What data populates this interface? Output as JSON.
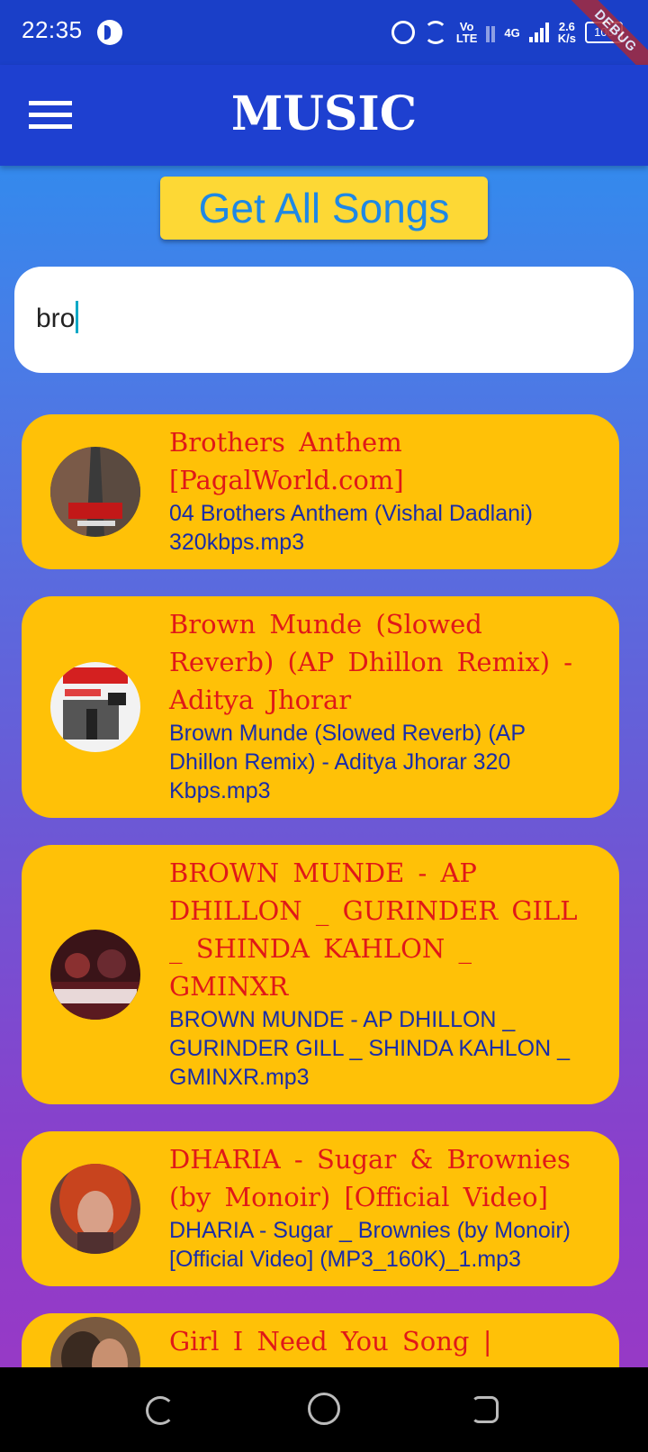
{
  "status_bar": {
    "time": "22:35",
    "volte_top": "Vo",
    "volte_bottom": "LTE",
    "network": "4G",
    "speed_value": "2.6",
    "speed_unit": "K/s",
    "battery": "100",
    "debug_label": "DEBUG"
  },
  "app_bar": {
    "title": "MUSIC",
    "menu_icon": "menu-icon"
  },
  "get_all_button": {
    "label": "Get All Songs"
  },
  "search": {
    "value": "bro"
  },
  "songs": [
    {
      "title": "Brothers Anthem [PagalWorld.com]",
      "file": "04 Brothers Anthem (Vishal Dadlani) 320kbps.mp3"
    },
    {
      "title": "Brown Munde (Slowed Reverb) (AP Dhillon Remix) - Aditya Jhorar",
      "file": "Brown Munde (Slowed  Reverb) (AP Dhillon Remix) - Aditya Jhorar 320 Kbps.mp3"
    },
    {
      "title": "BROWN MUNDE - AP DHILLON _ GURINDER GILL _ SHINDA KAHLON _ GMINXR",
      "file": "BROWN MUNDE - AP DHILLON _ GURINDER GILL _ SHINDA KAHLON _ GMINXR.mp3"
    },
    {
      "title": "DHARIA - Sugar & Brownies (by Monoir) [Official Video]",
      "file": "DHARIA - Sugar _ Brownies (by Monoir) [Official Video] (MP3_160K)_1.mp3"
    },
    {
      "title": "Girl I Need You Song | BAAGHI | Tiger, Shraddha |",
      "file": ""
    }
  ],
  "colors": {
    "app_bar": "#1E40D0",
    "card": "#FFC107",
    "title_text": "#E01818",
    "file_text": "#1A2DA8",
    "button": "#FDD835",
    "button_text": "#1E88E5"
  }
}
